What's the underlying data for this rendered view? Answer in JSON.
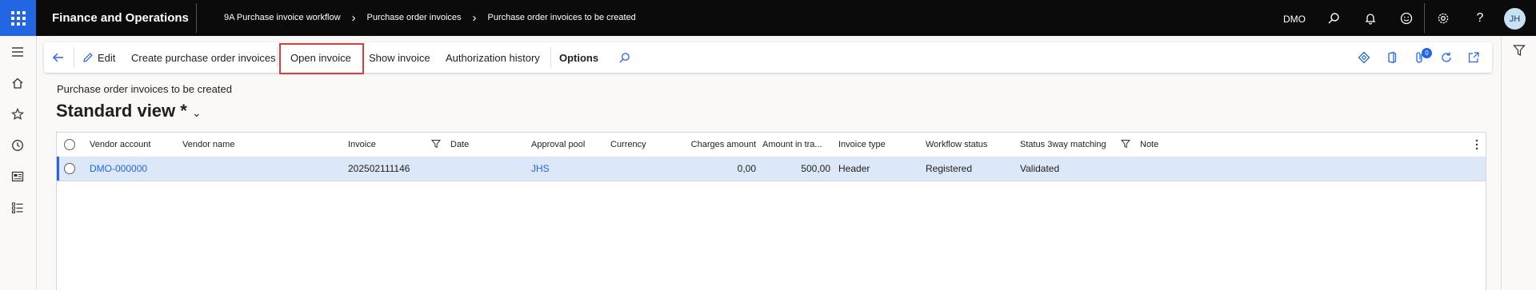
{
  "topbar": {
    "app_title": "Finance and Operations",
    "breadcrumb": [
      "9A Purchase invoice workflow",
      "Purchase order invoices",
      "Purchase order invoices to be created"
    ],
    "company": "DMO",
    "avatar_initials": "JH"
  },
  "actions": {
    "edit": "Edit",
    "create": "Create purchase order invoices",
    "open_invoice": "Open invoice",
    "show_invoice": "Show invoice",
    "authorization_history": "Authorization history",
    "options": "Options",
    "notification_count": "0"
  },
  "page": {
    "caption": "Purchase order invoices to be created",
    "view_name": "Standard view *"
  },
  "grid": {
    "columns": [
      "Vendor account",
      "Vendor name",
      "Invoice",
      "Date",
      "Approval pool",
      "Currency",
      "Charges amount",
      "Amount in tra...",
      "Invoice type",
      "Workflow status",
      "Status 3way matching",
      "Note"
    ],
    "rows": [
      {
        "vendor_account": "DMO-000000",
        "vendor_name": "",
        "invoice": "202502111146",
        "date": "",
        "approval_pool": "JHS",
        "currency": "",
        "charges_amount": "0,00",
        "amount": "500,00",
        "invoice_type": "Header",
        "workflow_status": "Registered",
        "status_3way": "Validated",
        "note": ""
      }
    ]
  },
  "colors": {
    "accent": "#2266e3",
    "topbar_bg": "#0b0b0b",
    "selected_row": "#dce7f8",
    "highlight": "#e03a3a"
  }
}
